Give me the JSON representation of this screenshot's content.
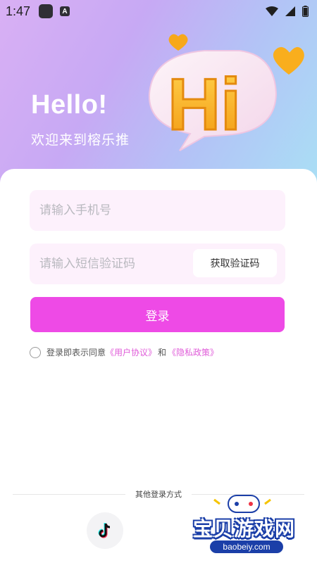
{
  "status_bar": {
    "time": "1:47",
    "notif_letter": "A"
  },
  "hero": {
    "greeting": "Hello!",
    "welcome": "欢迎来到榕乐推",
    "art_text": "Hi"
  },
  "form": {
    "phone_placeholder": "请输入手机号",
    "sms_placeholder": "请输入短信验证码",
    "get_code_label": "获取验证码",
    "login_label": "登录"
  },
  "agreement": {
    "prefix": "登录即表示同意",
    "user_agreement": "《用户协议》",
    "and": "和",
    "privacy_policy": "《隐私政策》",
    "checked": false
  },
  "other_login": {
    "title": "其他登录方式",
    "providers": [
      "tiktok-icon"
    ]
  },
  "watermark": {
    "title": "宝贝游戏网",
    "url": "baobeiy.com"
  },
  "colors": {
    "accent": "#ee4ae6",
    "link": "#e05cd9",
    "field_bg": "#fdf1fc",
    "hero_gradient": [
      "#d9b0f4",
      "#a9e0f5"
    ]
  }
}
